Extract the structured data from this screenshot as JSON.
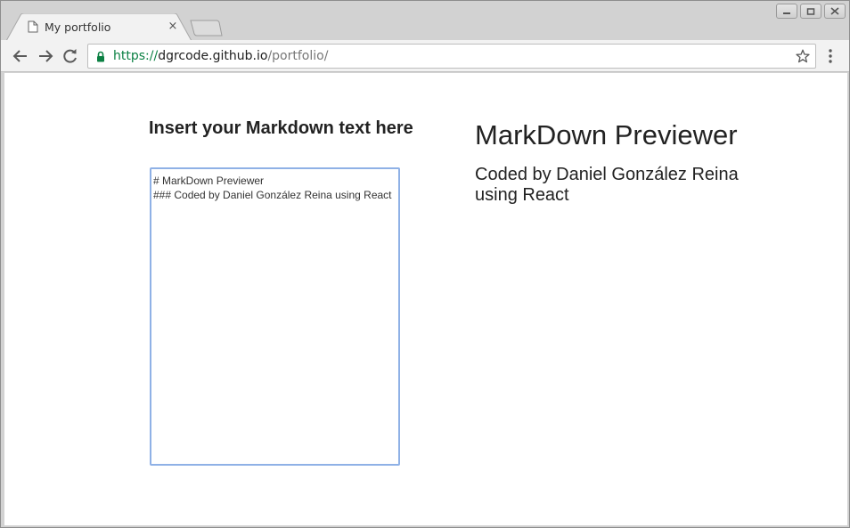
{
  "tab": {
    "title": "My portfolio",
    "close_glyph": "×",
    "icon": "page-icon"
  },
  "address": {
    "scheme": "https://",
    "host": "dgrcode.github.io",
    "path": "/portfolio/",
    "secure_icon": "lock-icon",
    "secure_color": "#0b8043"
  },
  "toolbar": {
    "icons": [
      "back-arrow-icon",
      "forward-arrow-icon",
      "reload-icon",
      "star-icon",
      "menu-icon"
    ]
  },
  "window_controls": [
    "minimize-icon",
    "restore-icon",
    "close-icon"
  ],
  "editor": {
    "heading": "Insert your Markdown text here",
    "value": "# MarkDown Previewer\n### Coded by Daniel González Reina using React",
    "focus_color": "#8fb1e6"
  },
  "preview": {
    "h1": "MarkDown Previewer",
    "h3": "Coded by Daniel González Reina using React"
  }
}
